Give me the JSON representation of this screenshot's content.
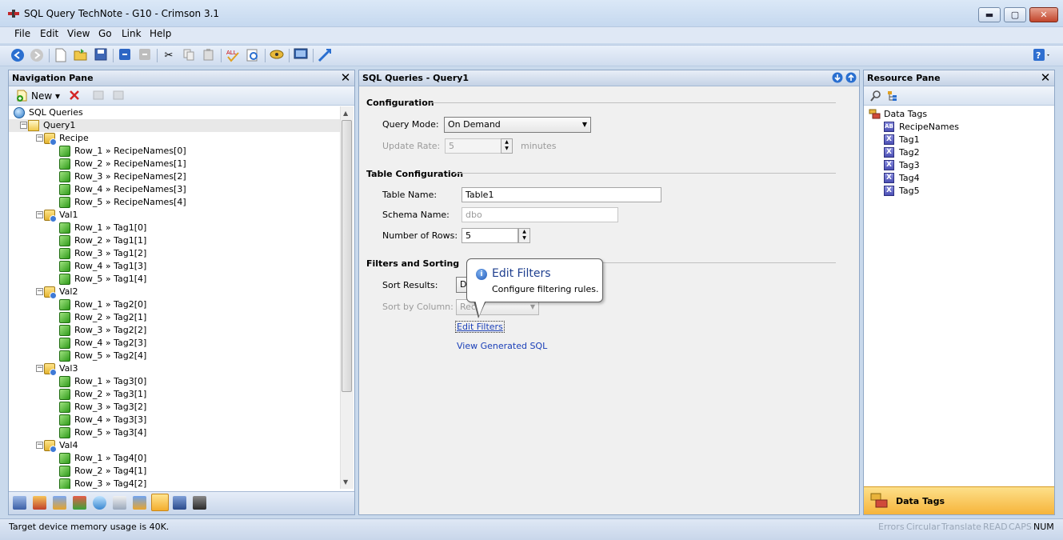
{
  "window": {
    "title": "SQL Query TechNote - G10 - Crimson 3.1",
    "controls": {
      "minimize": "▬",
      "maximize": "▢",
      "close": "✕"
    }
  },
  "menu": [
    "File",
    "Edit",
    "View",
    "Go",
    "Link",
    "Help"
  ],
  "navigation_pane": {
    "title": "Navigation Pane",
    "new_label": "New",
    "tree": [
      {
        "label": "SQL Queries",
        "level": 0,
        "icon": "globe-icon"
      },
      {
        "label": "Query1",
        "level": 1,
        "icon": "query-icon",
        "expander": "⊟"
      },
      {
        "label": "Recipe",
        "level": 2,
        "icon": "folder-icon",
        "expander": "⊟"
      },
      {
        "label": "Row_1 » RecipeNames[0]",
        "level": 3,
        "icon": "cube-icon"
      },
      {
        "label": "Row_2 » RecipeNames[1]",
        "level": 3,
        "icon": "cube-icon"
      },
      {
        "label": "Row_3 » RecipeNames[2]",
        "level": 3,
        "icon": "cube-icon"
      },
      {
        "label": "Row_4 » RecipeNames[3]",
        "level": 3,
        "icon": "cube-icon"
      },
      {
        "label": "Row_5 » RecipeNames[4]",
        "level": 3,
        "icon": "cube-icon"
      },
      {
        "label": "Val1",
        "level": 2,
        "icon": "folder-icon",
        "expander": "⊟"
      },
      {
        "label": "Row_1 » Tag1[0]",
        "level": 3,
        "icon": "cube-icon"
      },
      {
        "label": "Row_2 » Tag1[1]",
        "level": 3,
        "icon": "cube-icon"
      },
      {
        "label": "Row_3 » Tag1[2]",
        "level": 3,
        "icon": "cube-icon"
      },
      {
        "label": "Row_4 » Tag1[3]",
        "level": 3,
        "icon": "cube-icon"
      },
      {
        "label": "Row_5 » Tag1[4]",
        "level": 3,
        "icon": "cube-icon"
      },
      {
        "label": "Val2",
        "level": 2,
        "icon": "folder-icon",
        "expander": "⊟"
      },
      {
        "label": "Row_1 » Tag2[0]",
        "level": 3,
        "icon": "cube-icon"
      },
      {
        "label": "Row_2 » Tag2[1]",
        "level": 3,
        "icon": "cube-icon"
      },
      {
        "label": "Row_3 » Tag2[2]",
        "level": 3,
        "icon": "cube-icon"
      },
      {
        "label": "Row_4 » Tag2[3]",
        "level": 3,
        "icon": "cube-icon"
      },
      {
        "label": "Row_5 » Tag2[4]",
        "level": 3,
        "icon": "cube-icon"
      },
      {
        "label": "Val3",
        "level": 2,
        "icon": "folder-icon",
        "expander": "⊟"
      },
      {
        "label": "Row_1 » Tag3[0]",
        "level": 3,
        "icon": "cube-icon"
      },
      {
        "label": "Row_2 » Tag3[1]",
        "level": 3,
        "icon": "cube-icon"
      },
      {
        "label": "Row_3 » Tag3[2]",
        "level": 3,
        "icon": "cube-icon"
      },
      {
        "label": "Row_4 » Tag3[3]",
        "level": 3,
        "icon": "cube-icon"
      },
      {
        "label": "Row_5 » Tag3[4]",
        "level": 3,
        "icon": "cube-icon"
      },
      {
        "label": "Val4",
        "level": 2,
        "icon": "folder-icon",
        "expander": "⊟"
      },
      {
        "label": "Row_1 » Tag4[0]",
        "level": 3,
        "icon": "cube-icon"
      },
      {
        "label": "Row_2 » Tag4[1]",
        "level": 3,
        "icon": "cube-icon"
      },
      {
        "label": "Row_3 » Tag4[2]",
        "level": 3,
        "icon": "cube-icon"
      }
    ]
  },
  "editor": {
    "title": "SQL Queries - Query1",
    "configuration": {
      "heading": "Configuration",
      "query_mode_label": "Query Mode:",
      "query_mode_value": "On Demand",
      "update_rate_label": "Update Rate:",
      "update_rate_value": "5",
      "update_rate_units": "minutes"
    },
    "table_configuration": {
      "heading": "Table Configuration",
      "table_name_label": "Table Name:",
      "table_name_value": "Table1",
      "schema_name_label": "Schema Name:",
      "schema_name_placeholder": "dbo",
      "rows_label": "Number of Rows:",
      "rows_value": "5"
    },
    "filters": {
      "heading": "Filters and Sorting",
      "sort_results_label": "Sort Results:",
      "sort_results_value": "D",
      "sort_column_label": "Sort by Column:",
      "sort_column_value": "Reci",
      "edit_filters_link": "Edit Filters",
      "view_sql_link": "View Generated SQL"
    },
    "tooltip": {
      "title": "Edit Filters",
      "body": "Configure filtering rules."
    }
  },
  "resource_pane": {
    "title": "Resource Pane",
    "root": "Data Tags",
    "items": [
      "RecipeNames",
      "Tag1",
      "Tag2",
      "Tag3",
      "Tag4",
      "Tag5"
    ],
    "footer": "Data Tags"
  },
  "status": {
    "message": "Target device memory usage is 40K.",
    "indicators": [
      "Errors",
      "Circular",
      "Translate",
      "READ",
      "CAPS"
    ],
    "active_indicator": "NUM"
  }
}
